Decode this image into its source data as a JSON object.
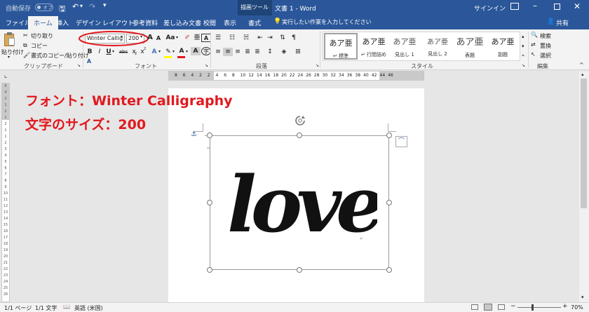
{
  "titlebar": {
    "autosave_label": "自動保存",
    "autosave_state": "オフ",
    "context_tools_label": "描画ツール",
    "document_title": "文書 1 - Word",
    "signin_label": "サインイン"
  },
  "tabs": [
    {
      "label": "ファイル"
    },
    {
      "label": "ホーム"
    },
    {
      "label": "挿入"
    },
    {
      "label": "デザイン"
    },
    {
      "label": "レイアウト"
    },
    {
      "label": "参考資料"
    },
    {
      "label": "差し込み文書"
    },
    {
      "label": "校閲"
    },
    {
      "label": "表示"
    },
    {
      "label": "書式"
    }
  ],
  "tellme_placeholder": "実行したい作業を入力してください",
  "share_label": "共有",
  "clipboard": {
    "paste_label": "貼り付け",
    "cut_label": "切り取り",
    "copy_label": "コピー",
    "format_painter_label": "書式のコピー/貼り付け",
    "group_label": "クリップボード"
  },
  "font": {
    "font_name": "Winter Callig",
    "font_size": "200",
    "group_label": "フォント",
    "grow_glyph": "A",
    "shrink_glyph": "A",
    "case_glyph": "Aa",
    "bold": "B",
    "italic": "I",
    "underline": "U",
    "strike": "abc",
    "subscript": "x",
    "superscript": "x",
    "font_color_glyph": "A",
    "char_shade_glyph": "A",
    "enclose_glyph": "A"
  },
  "paragraph": {
    "group_label": "段落"
  },
  "styles": {
    "group_label": "スタイル",
    "items": [
      {
        "sample": "あア亜",
        "name": "↵ 標準"
      },
      {
        "sample": "あア亜",
        "name": "↵ 行間詰め"
      },
      {
        "sample": "あア亜",
        "name": "見出し 1"
      },
      {
        "sample": "あア亜",
        "name": "見出し 2"
      },
      {
        "sample": "あア亜",
        "name": "表題"
      },
      {
        "sample": "あア亜",
        "name": "副題"
      }
    ]
  },
  "editing": {
    "group_label": "編集",
    "find_label": "検索",
    "replace_label": "置換",
    "select_label": "選択"
  },
  "ruler_h_numbers": [
    "8",
    "6",
    "4",
    "2",
    "2",
    "4",
    "6",
    "8",
    "10",
    "12",
    "14",
    "16",
    "18",
    "20",
    "22",
    "24",
    "26",
    "28",
    "30",
    "32",
    "34",
    "36",
    "38",
    "40",
    "42",
    "44",
    "46"
  ],
  "annotation": {
    "line1": "フォント：Winter Calligraphy",
    "line2": "文字のサイズ：200"
  },
  "document": {
    "word": "love"
  },
  "statusbar": {
    "page_info": "1/1 ページ",
    "word_count": "1/1 文字",
    "language": "英語 (米国)",
    "zoom": "70%"
  },
  "colors": {
    "ribbon_blue": "#2b579a",
    "annotation_red": "#e0191e"
  }
}
